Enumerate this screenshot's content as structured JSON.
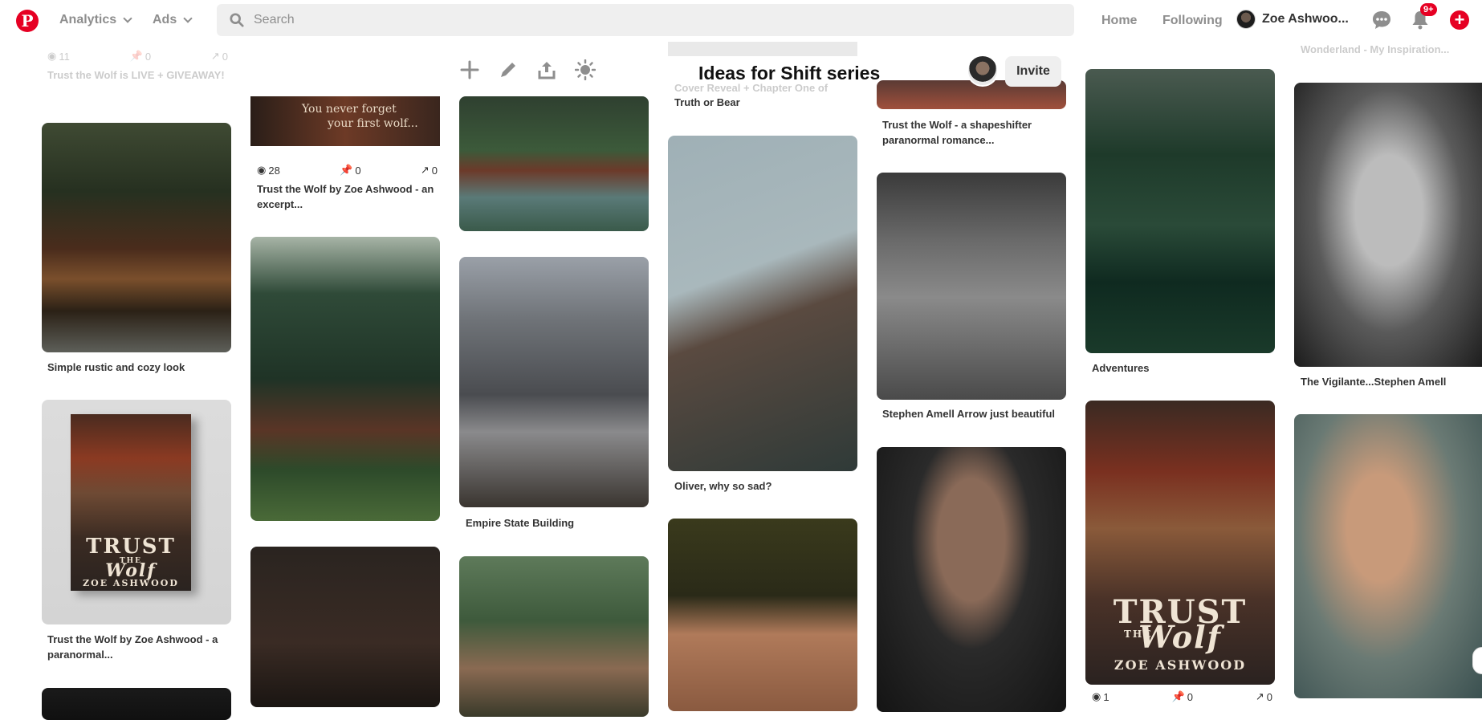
{
  "header": {
    "logo_letter": "P",
    "nav": [
      {
        "label": "Analytics"
      },
      {
        "label": "Ads"
      }
    ],
    "search_placeholder": "Search",
    "links": {
      "home": "Home",
      "following": "Following"
    },
    "user_name": "Zoe Ashwoo...",
    "notification_badge": "9+",
    "create_symbol": "+"
  },
  "board": {
    "title": "Ideas for Shift series",
    "invite_label": "Invite",
    "tools": [
      "add-icon",
      "pencil-icon",
      "share-icon",
      "sun-icon"
    ]
  },
  "pins": {
    "c1_top_caption": "Trust the Wolf is LIVE + GIVEAWAY!",
    "c1_top_stats": [
      "11",
      "0",
      "0"
    ],
    "c1_p1_caption": "Simple rustic and cozy look",
    "c1_p2_caption": "Trust the Wolf by Zoe Ashwood - a paranormal...",
    "c1_p2_cover_title": "TRUST",
    "c1_p2_cover_the": "THE",
    "c1_p2_cover_wolf": "Wolf",
    "c1_p2_cover_author": "ZOE ASHWOOD",
    "c2_banner_line1": "You never forget",
    "c2_banner_line2": "your first wolf...",
    "c2_banner_stats": [
      "28",
      "0",
      "0"
    ],
    "c2_banner_caption": "Trust the Wolf by Zoe Ashwood - an excerpt...",
    "c3_p2_caption": "Empire State Building",
    "c4_top_caption_faded": "Cover Reveal + Chapter One of",
    "c4_top_caption": "Truth or Bear",
    "c4_p1_caption": "Oliver, why so sad?",
    "c5_top_caption": "Trust the Wolf - a shapeshifter paranormal romance...",
    "c5_p1_caption": "Stephen Amell Arrow just beautiful",
    "c6_p1_caption": "Adventures",
    "c6_p2_cover_title": "TRUST",
    "c6_p2_cover_the": "THE",
    "c6_p2_cover_wolf": "Wolf",
    "c6_p2_cover_author": "ZOE ASHWOOD",
    "c6_p2_stats": [
      "1",
      "0",
      "0"
    ],
    "c7_top_caption": "Wonderland - My Inspiration...",
    "c7_p1_caption": "The Vigilante...Stephen Amell"
  },
  "colors": {
    "brand": "#e60023",
    "text_muted": "#8e8e8e",
    "search_bg": "#efefef"
  }
}
